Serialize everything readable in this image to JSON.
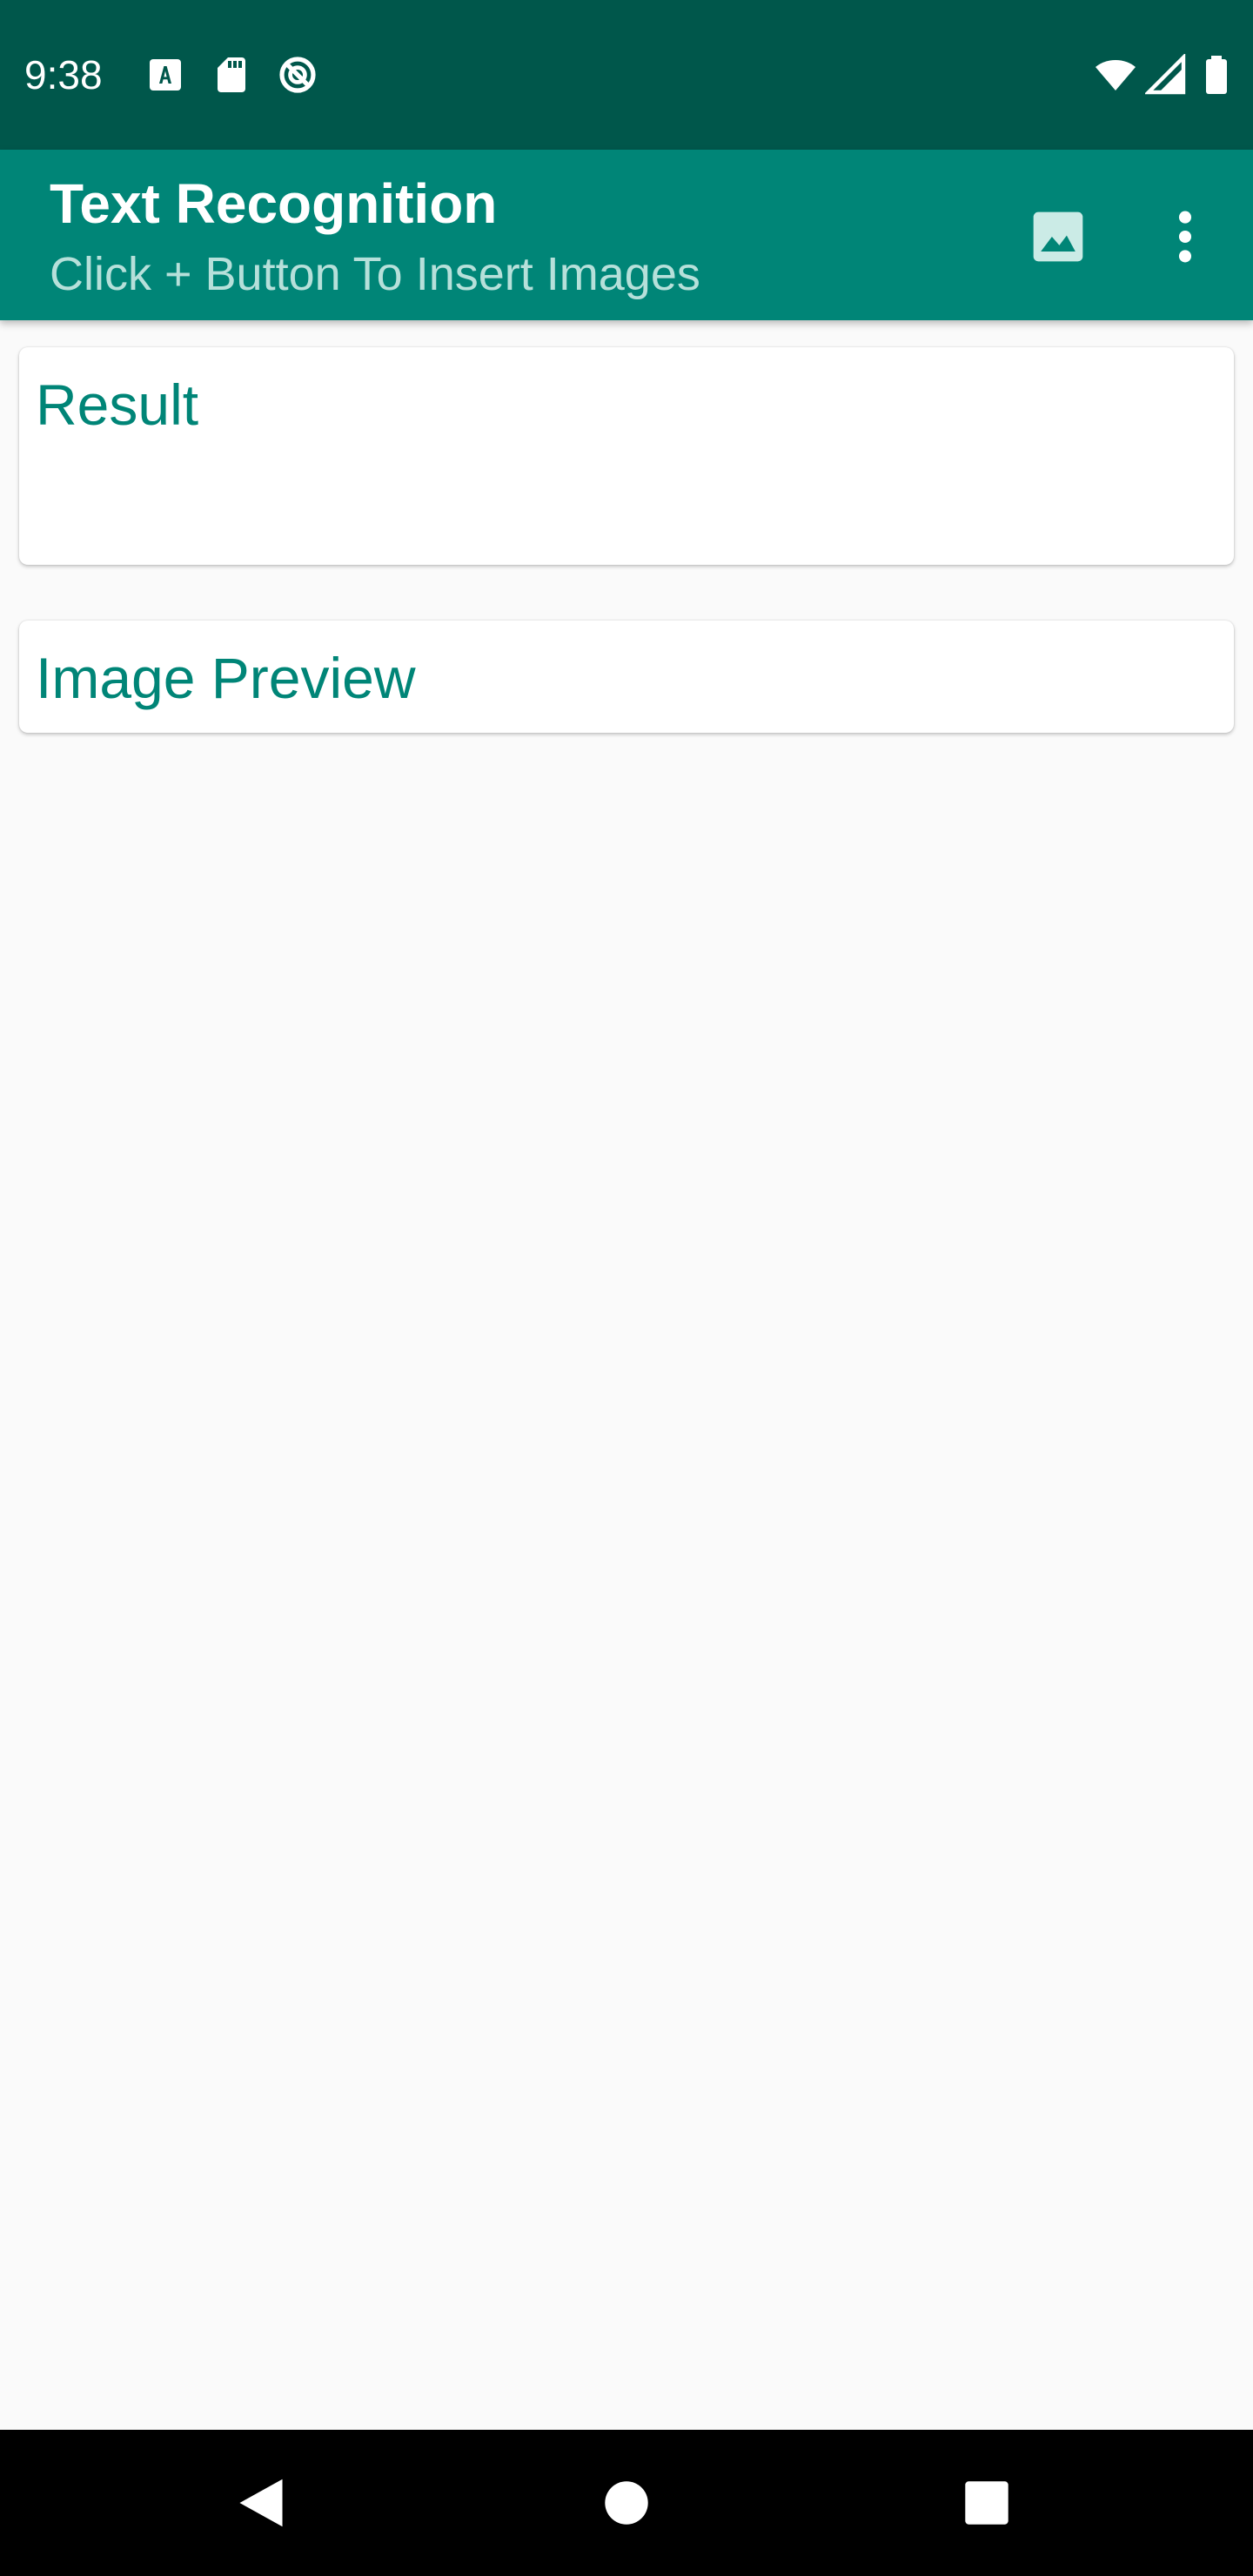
{
  "status_bar": {
    "time": "9:38",
    "left_icons": [
      "font-download-icon",
      "sd-card-icon",
      "do-not-disturb-icon"
    ],
    "right_icons": [
      "wifi-icon",
      "cellular-signal-icon",
      "battery-icon"
    ]
  },
  "app_bar": {
    "title": "Text Recognition",
    "subtitle": "Click + Button To Insert Images",
    "actions": [
      "image-icon",
      "more-vert-icon"
    ]
  },
  "cards": {
    "result": {
      "title": "Result"
    },
    "preview": {
      "title": "Image Preview"
    }
  },
  "nav_bar": {
    "buttons": [
      "back-icon",
      "home-icon",
      "recents-icon"
    ]
  },
  "colors": {
    "status_bar": "#00574b",
    "app_bar": "#008577",
    "accent_text": "#008577",
    "subtitle_text": "#b6e0da",
    "background": "#fafafa",
    "nav_bar": "#000000"
  }
}
